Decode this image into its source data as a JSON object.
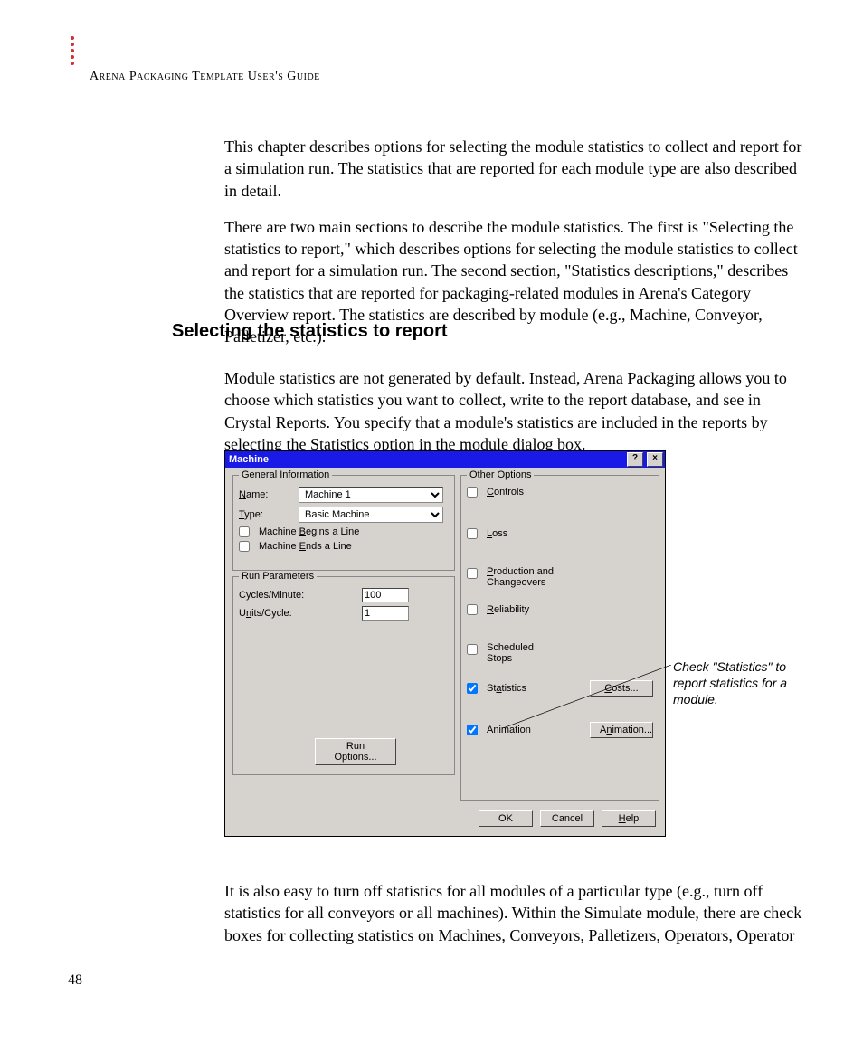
{
  "header": {
    "running": "Arena Packaging Template User's Guide"
  },
  "para1": "This chapter describes options for selecting the module statistics to collect and report for a simulation run. The statistics that are reported for each module type are also described in detail.",
  "para2": "There are two main sections to describe the module statistics. The first is \"Selecting the statistics to report,\" which describes options for selecting the module statistics to collect and report for a simulation run. The second section, \"Statistics descriptions,\" describes the statistics that are reported for packaging-related modules in Arena's Category Overview report. The statistics are described by module (e.g., Machine, Conveyor, Palletizer, etc.).",
  "sectionHead": "Selecting the statistics to report",
  "para3": "Module statistics are not generated by default. Instead, Arena Packaging allows you to choose which statistics you want to collect, write to the report database, and see in Crystal Reports. You specify that a module's statistics are included in the reports by selecting the Statistics option in the module dialog box.",
  "para4": "It is also easy to turn off statistics for all modules of a particular type (e.g., turn off statistics for all conveyors or all machines). Within the Simulate module, there are check boxes for collecting statistics on Machines, Conveyors, Palletizers, Operators, Operator",
  "pageNum": "48",
  "annotation": "Check \"Statistics\" to report statistics for a module.",
  "dialog": {
    "title": "Machine",
    "group1": {
      "legend": "General Information",
      "nameLabel": "Name:",
      "nameValue": "Machine 1",
      "typeLabel": "Type:",
      "typeValue": "Basic Machine",
      "beginsLine": "Machine Begins a Line",
      "endsLine": "Machine Ends a Line"
    },
    "group2": {
      "legend": "Run Parameters",
      "cyclesLabel": "Cycles/Minute:",
      "cyclesValue": "100",
      "unitsLabel": "Units/Cycle:",
      "unitsValue": "1",
      "runOptions": "Run Options..."
    },
    "group3": {
      "legend": "Other Options",
      "controls": "Controls",
      "loss": "Loss",
      "prodChange": "Production and Changeovers",
      "reliability": "Reliability",
      "schedStops": "Scheduled Stops",
      "statistics": "Statistics",
      "animation": "Animation",
      "costsBtn": "Costs...",
      "animBtn": "Animation..."
    },
    "buttons": {
      "ok": "OK",
      "cancel": "Cancel",
      "help": "Help"
    }
  }
}
